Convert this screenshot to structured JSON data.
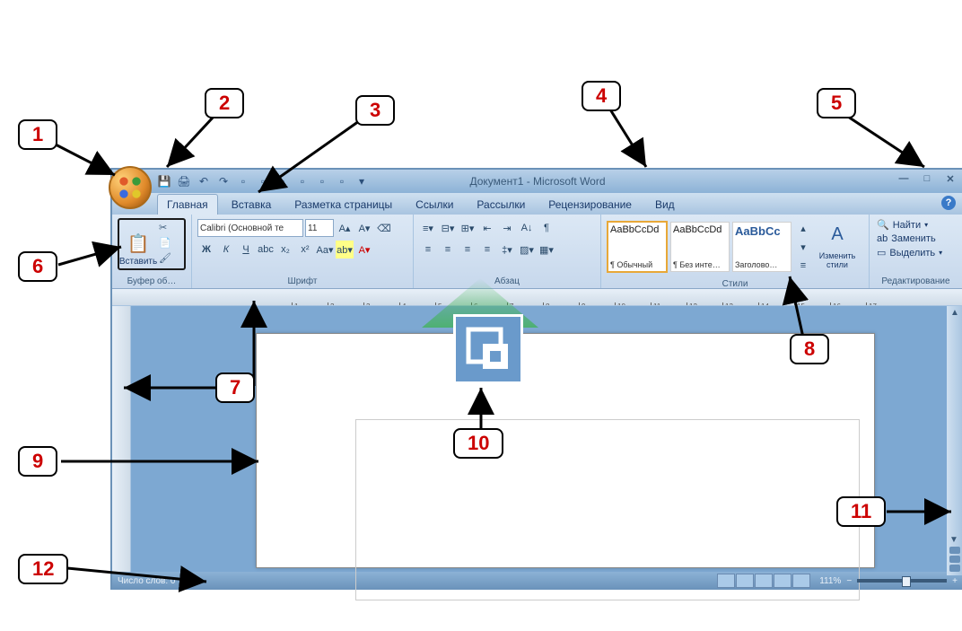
{
  "title": "Документ1 - Microsoft Word",
  "tabs": [
    "Главная",
    "Вставка",
    "Разметка страницы",
    "Ссылки",
    "Рассылки",
    "Рецензирование",
    "Вид"
  ],
  "activeTab": 0,
  "clipboard": {
    "paste": "Вставить",
    "label": "Буфер об…"
  },
  "font": {
    "name": "Calibri (Основной те",
    "size": "11",
    "label": "Шрифт",
    "b": "Ж",
    "i": "К",
    "u": "Ч"
  },
  "paragraph": {
    "label": "Абзац"
  },
  "styles": {
    "label": "Стили",
    "items": [
      {
        "preview": "AaBbCcDd",
        "name": "¶ Обычный"
      },
      {
        "preview": "AaBbCcDd",
        "name": "¶ Без инте…"
      },
      {
        "preview": "AaBbCc",
        "name": "Заголово…"
      }
    ],
    "change": "Изменить стили"
  },
  "editing": {
    "find": "Найти",
    "replace": "Заменить",
    "select": "Выделить",
    "label": "Редактирование"
  },
  "status": {
    "words": "Число слов: 0",
    "zoom": "111%"
  },
  "callouts": {
    "c1": "1",
    "c2": "2",
    "c3": "3",
    "c4": "4",
    "c5": "5",
    "c6": "6",
    "c7": "7",
    "c8": "8",
    "c9": "9",
    "c10": "10",
    "c11": "11",
    "c12": "12"
  }
}
